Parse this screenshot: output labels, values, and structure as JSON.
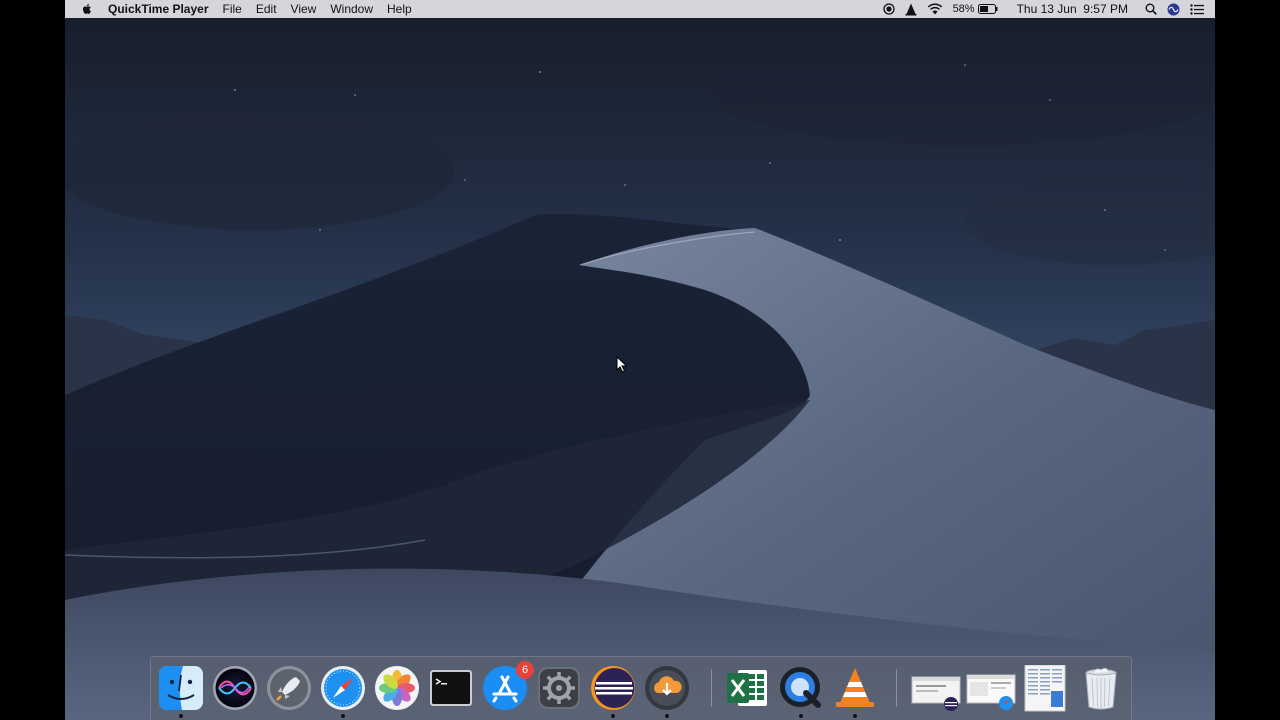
{
  "menubar": {
    "app_name": "QuickTime Player",
    "menus": [
      "File",
      "Edit",
      "View",
      "Window",
      "Help"
    ],
    "status": {
      "battery_percent": "58%",
      "datetime": "Thu 13 Jun  9:57 PM"
    },
    "icons": [
      "apple-icon",
      "record-icon",
      "vlc-status-icon",
      "wifi-icon",
      "battery-icon",
      "search-icon",
      "siri-icon",
      "notification-list-icon"
    ]
  },
  "dock": {
    "apps": [
      {
        "name": "finder-icon",
        "running": true
      },
      {
        "name": "siri-icon",
        "running": false
      },
      {
        "name": "launchpad-icon",
        "running": false
      },
      {
        "name": "safari-icon",
        "running": true
      },
      {
        "name": "photos-icon",
        "running": false
      },
      {
        "name": "terminal-icon",
        "running": false
      },
      {
        "name": "app-store-icon",
        "running": false,
        "badge": "6"
      },
      {
        "name": "system-preferences-icon",
        "running": false
      },
      {
        "name": "eclipse-icon",
        "running": true
      },
      {
        "name": "downloader-icon",
        "running": true
      },
      {
        "name": "excel-icon",
        "running": false
      },
      {
        "name": "quicktime-icon",
        "running": true
      },
      {
        "name": "vlc-icon",
        "running": true
      }
    ],
    "minimized": [
      "minimized-window-eclipse",
      "minimized-window-safari",
      "documents-stack"
    ],
    "trash": "trash-icon"
  },
  "colors": {
    "sky_top": "#1b2230",
    "dune_dark": "#121a2b",
    "dune_light": "#6f7d96",
    "badge": "#e8413b"
  }
}
